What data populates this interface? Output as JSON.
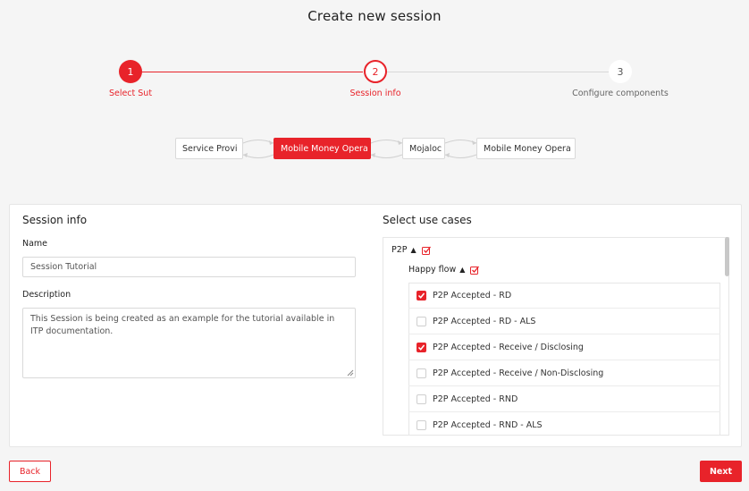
{
  "page": {
    "title": "Create new session"
  },
  "stepper": {
    "steps": [
      {
        "number": "1",
        "label": "Select Sut",
        "state": "completed"
      },
      {
        "number": "2",
        "label": "Session info",
        "state": "active"
      },
      {
        "number": "3",
        "label": "Configure components",
        "state": "pending"
      }
    ]
  },
  "diagram": {
    "components": [
      {
        "label": "Service Provi",
        "active": false
      },
      {
        "label": "Mobile Money Opera",
        "active": true
      },
      {
        "label": "Mojaloc",
        "active": false
      },
      {
        "label": "Mobile Money Opera",
        "active": false
      }
    ]
  },
  "session_info": {
    "title": "Session info",
    "name_label": "Name",
    "name_value": "Session Tutorial",
    "description_label": "Description",
    "description_value": "This Session is being created as an example for the tutorial available in ITP documentation."
  },
  "use_cases": {
    "title": "Select use cases",
    "group": {
      "label": "P2P",
      "expanded": true,
      "icon": "check-square-icon"
    },
    "subgroup": {
      "label": "Happy flow",
      "expanded": true,
      "icon": "check-square-icon"
    },
    "items": [
      {
        "label": "P2P Accepted - RD",
        "checked": true
      },
      {
        "label": "P2P Accepted - RD - ALS",
        "checked": false
      },
      {
        "label": "P2P Accepted - Receive / Disclosing",
        "checked": true
      },
      {
        "label": "P2P Accepted - Receive / Non-Disclosing",
        "checked": false
      },
      {
        "label": "P2P Accepted - RND",
        "checked": false
      },
      {
        "label": "P2P Accepted - RND - ALS",
        "checked": false
      }
    ]
  },
  "footer": {
    "back_label": "Back",
    "next_label": "Next"
  },
  "colors": {
    "accent": "#e8232a",
    "border": "#d9d9d9",
    "background": "#f5f5f5"
  }
}
